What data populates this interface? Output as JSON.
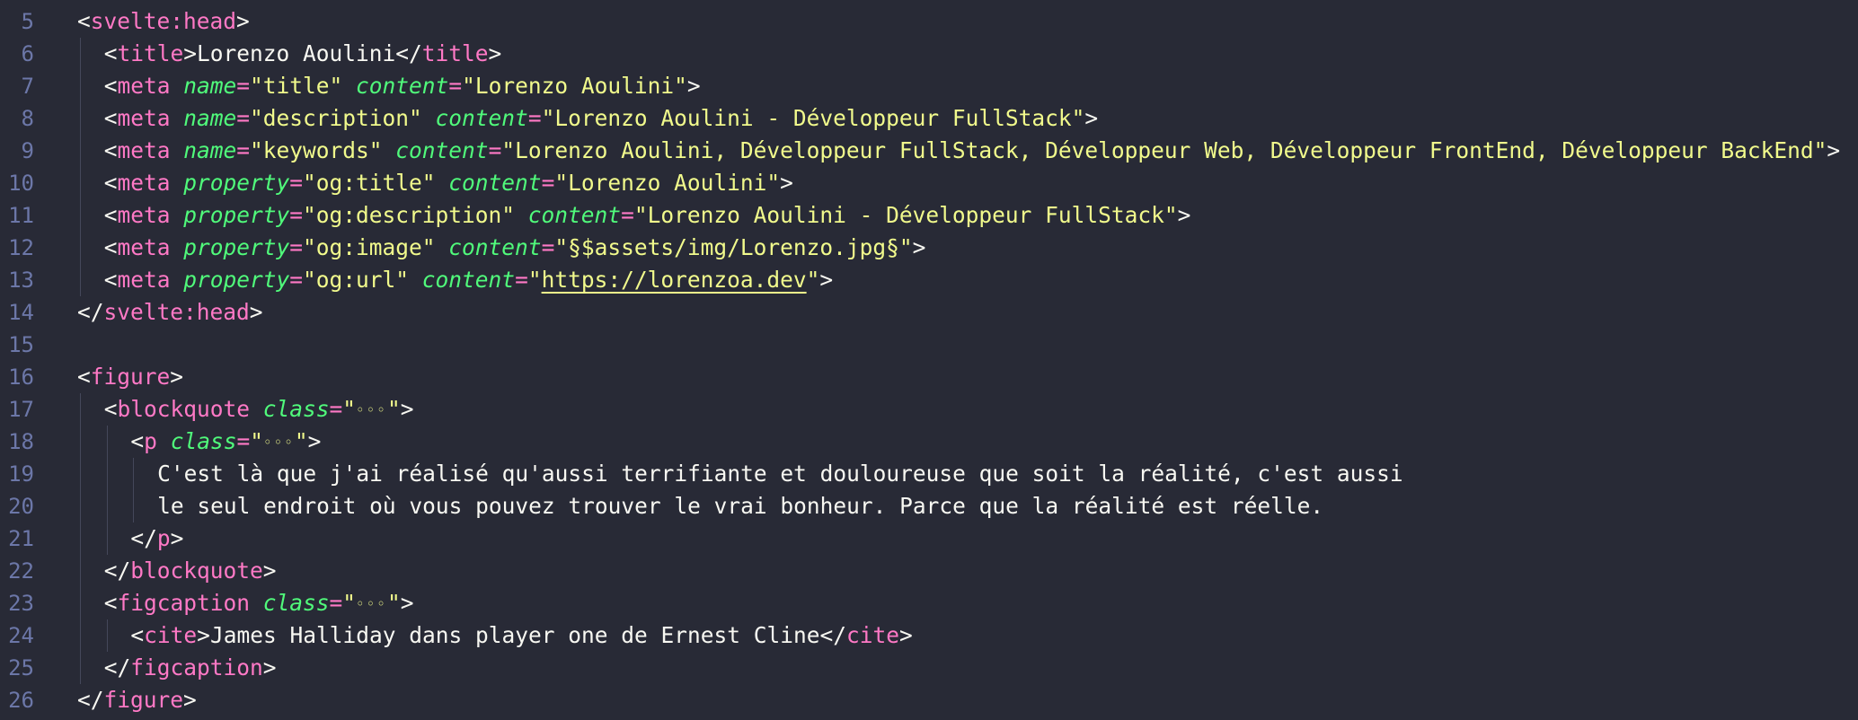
{
  "editor": {
    "language": "svelte",
    "theme_colors": {
      "background": "#282a36",
      "line_number": "#6c77a8",
      "tag": "#ff79c6",
      "attribute": "#50fa7b",
      "string": "#f1fa8c",
      "text": "#f8f8f2",
      "indent_guide": "#44475a"
    },
    "lines": [
      {
        "n": "5",
        "indent": 0,
        "tokens": [
          [
            "punc",
            "<"
          ],
          [
            "tag",
            "svelte:head"
          ],
          [
            "punc",
            ">"
          ]
        ]
      },
      {
        "n": "6",
        "indent": 1,
        "tokens": [
          [
            "punc",
            "<"
          ],
          [
            "tag",
            "title"
          ],
          [
            "punc",
            ">"
          ],
          [
            "text",
            "Lorenzo Aoulini"
          ],
          [
            "punc",
            "</"
          ],
          [
            "tag",
            "title"
          ],
          [
            "punc",
            ">"
          ]
        ]
      },
      {
        "n": "7",
        "indent": 1,
        "tokens": [
          [
            "punc",
            "<"
          ],
          [
            "tag",
            "meta"
          ],
          [
            "punc",
            " "
          ],
          [
            "attr",
            "name"
          ],
          [
            "op",
            "="
          ],
          [
            "str",
            "\"title\""
          ],
          [
            "punc",
            " "
          ],
          [
            "attr",
            "content"
          ],
          [
            "op",
            "="
          ],
          [
            "str",
            "\"Lorenzo Aoulini\""
          ],
          [
            "punc",
            ">"
          ]
        ]
      },
      {
        "n": "8",
        "indent": 1,
        "tokens": [
          [
            "punc",
            "<"
          ],
          [
            "tag",
            "meta"
          ],
          [
            "punc",
            " "
          ],
          [
            "attr",
            "name"
          ],
          [
            "op",
            "="
          ],
          [
            "str",
            "\"description\""
          ],
          [
            "punc",
            " "
          ],
          [
            "attr",
            "content"
          ],
          [
            "op",
            "="
          ],
          [
            "str",
            "\"Lorenzo Aoulini - Développeur FullStack\""
          ],
          [
            "punc",
            ">"
          ]
        ]
      },
      {
        "n": "9",
        "indent": 1,
        "tokens": [
          [
            "punc",
            "<"
          ],
          [
            "tag",
            "meta"
          ],
          [
            "punc",
            " "
          ],
          [
            "attr",
            "name"
          ],
          [
            "op",
            "="
          ],
          [
            "str",
            "\"keywords\""
          ],
          [
            "punc",
            " "
          ],
          [
            "attr",
            "content"
          ],
          [
            "op",
            "="
          ],
          [
            "str",
            "\"Lorenzo Aoulini, Développeur FullStack, Développeur Web, Développeur FrontEnd, Développeur BackEnd\""
          ],
          [
            "punc",
            ">"
          ]
        ]
      },
      {
        "n": "10",
        "indent": 1,
        "tokens": [
          [
            "punc",
            "<"
          ],
          [
            "tag",
            "meta"
          ],
          [
            "punc",
            " "
          ],
          [
            "attr",
            "property"
          ],
          [
            "op",
            "="
          ],
          [
            "str",
            "\"og:title\""
          ],
          [
            "punc",
            " "
          ],
          [
            "attr",
            "content"
          ],
          [
            "op",
            "="
          ],
          [
            "str",
            "\"Lorenzo Aoulini\""
          ],
          [
            "punc",
            ">"
          ]
        ]
      },
      {
        "n": "11",
        "indent": 1,
        "tokens": [
          [
            "punc",
            "<"
          ],
          [
            "tag",
            "meta"
          ],
          [
            "punc",
            " "
          ],
          [
            "attr",
            "property"
          ],
          [
            "op",
            "="
          ],
          [
            "str",
            "\"og:description\""
          ],
          [
            "punc",
            " "
          ],
          [
            "attr",
            "content"
          ],
          [
            "op",
            "="
          ],
          [
            "str",
            "\"Lorenzo Aoulini - Développeur FullStack\""
          ],
          [
            "punc",
            ">"
          ]
        ]
      },
      {
        "n": "12",
        "indent": 1,
        "tokens": [
          [
            "punc",
            "<"
          ],
          [
            "tag",
            "meta"
          ],
          [
            "punc",
            " "
          ],
          [
            "attr",
            "property"
          ],
          [
            "op",
            "="
          ],
          [
            "str",
            "\"og:image\""
          ],
          [
            "punc",
            " "
          ],
          [
            "attr",
            "content"
          ],
          [
            "op",
            "="
          ],
          [
            "str",
            "\"§$assets/img/Lorenzo.jpg§\""
          ],
          [
            "punc",
            ">"
          ]
        ]
      },
      {
        "n": "13",
        "indent": 1,
        "tokens": [
          [
            "punc",
            "<"
          ],
          [
            "tag",
            "meta"
          ],
          [
            "punc",
            " "
          ],
          [
            "attr",
            "property"
          ],
          [
            "op",
            "="
          ],
          [
            "str",
            "\"og:url\""
          ],
          [
            "punc",
            " "
          ],
          [
            "attr",
            "content"
          ],
          [
            "op",
            "="
          ],
          [
            "str",
            "\""
          ],
          [
            "link",
            "https://lorenzoa.dev"
          ],
          [
            "str",
            "\""
          ],
          [
            "punc",
            ">"
          ]
        ]
      },
      {
        "n": "14",
        "indent": 0,
        "tokens": [
          [
            "punc",
            "</"
          ],
          [
            "tag",
            "svelte:head"
          ],
          [
            "punc",
            ">"
          ]
        ]
      },
      {
        "n": "15",
        "indent": 0,
        "tokens": []
      },
      {
        "n": "16",
        "indent": 0,
        "tokens": [
          [
            "punc",
            "<"
          ],
          [
            "tag",
            "figure"
          ],
          [
            "punc",
            ">"
          ]
        ]
      },
      {
        "n": "17",
        "indent": 1,
        "tokens": [
          [
            "punc",
            "<"
          ],
          [
            "tag",
            "blockquote"
          ],
          [
            "punc",
            " "
          ],
          [
            "attr",
            "class"
          ],
          [
            "op",
            "="
          ],
          [
            "str",
            "\""
          ],
          [
            "fold",
            "◦◦◦"
          ],
          [
            "str",
            "\""
          ],
          [
            "punc",
            ">"
          ]
        ]
      },
      {
        "n": "18",
        "indent": 2,
        "tokens": [
          [
            "punc",
            "<"
          ],
          [
            "tag",
            "p"
          ],
          [
            "punc",
            " "
          ],
          [
            "attr",
            "class"
          ],
          [
            "op",
            "="
          ],
          [
            "str",
            "\""
          ],
          [
            "fold",
            "◦◦◦"
          ],
          [
            "str",
            "\""
          ],
          [
            "punc",
            ">"
          ]
        ]
      },
      {
        "n": "19",
        "indent": 3,
        "tokens": [
          [
            "text",
            "C'est là que j'ai réalisé qu'aussi terrifiante et douloureuse que soit la réalité, c'est aussi"
          ]
        ]
      },
      {
        "n": "20",
        "indent": 3,
        "tokens": [
          [
            "text",
            "le seul endroit où vous pouvez trouver le vrai bonheur. Parce que la réalité est réelle."
          ]
        ]
      },
      {
        "n": "21",
        "indent": 2,
        "tokens": [
          [
            "punc",
            "</"
          ],
          [
            "tag",
            "p"
          ],
          [
            "punc",
            ">"
          ]
        ]
      },
      {
        "n": "22",
        "indent": 1,
        "tokens": [
          [
            "punc",
            "</"
          ],
          [
            "tag",
            "blockquote"
          ],
          [
            "punc",
            ">"
          ]
        ]
      },
      {
        "n": "23",
        "indent": 1,
        "tokens": [
          [
            "punc",
            "<"
          ],
          [
            "tag",
            "figcaption"
          ],
          [
            "punc",
            " "
          ],
          [
            "attr",
            "class"
          ],
          [
            "op",
            "="
          ],
          [
            "str",
            "\""
          ],
          [
            "fold",
            "◦◦◦"
          ],
          [
            "str",
            "\""
          ],
          [
            "punc",
            ">"
          ]
        ]
      },
      {
        "n": "24",
        "indent": 2,
        "tokens": [
          [
            "punc",
            "<"
          ],
          [
            "tag",
            "cite"
          ],
          [
            "punc",
            ">"
          ],
          [
            "text",
            "James Halliday dans player one de Ernest Cline"
          ],
          [
            "punc",
            "</"
          ],
          [
            "tag",
            "cite"
          ],
          [
            "punc",
            ">"
          ]
        ]
      },
      {
        "n": "25",
        "indent": 1,
        "tokens": [
          [
            "punc",
            "</"
          ],
          [
            "tag",
            "figcaption"
          ],
          [
            "punc",
            ">"
          ]
        ]
      },
      {
        "n": "26",
        "indent": 0,
        "tokens": [
          [
            "punc",
            "</"
          ],
          [
            "tag",
            "figure"
          ],
          [
            "punc",
            ">"
          ]
        ]
      }
    ]
  }
}
